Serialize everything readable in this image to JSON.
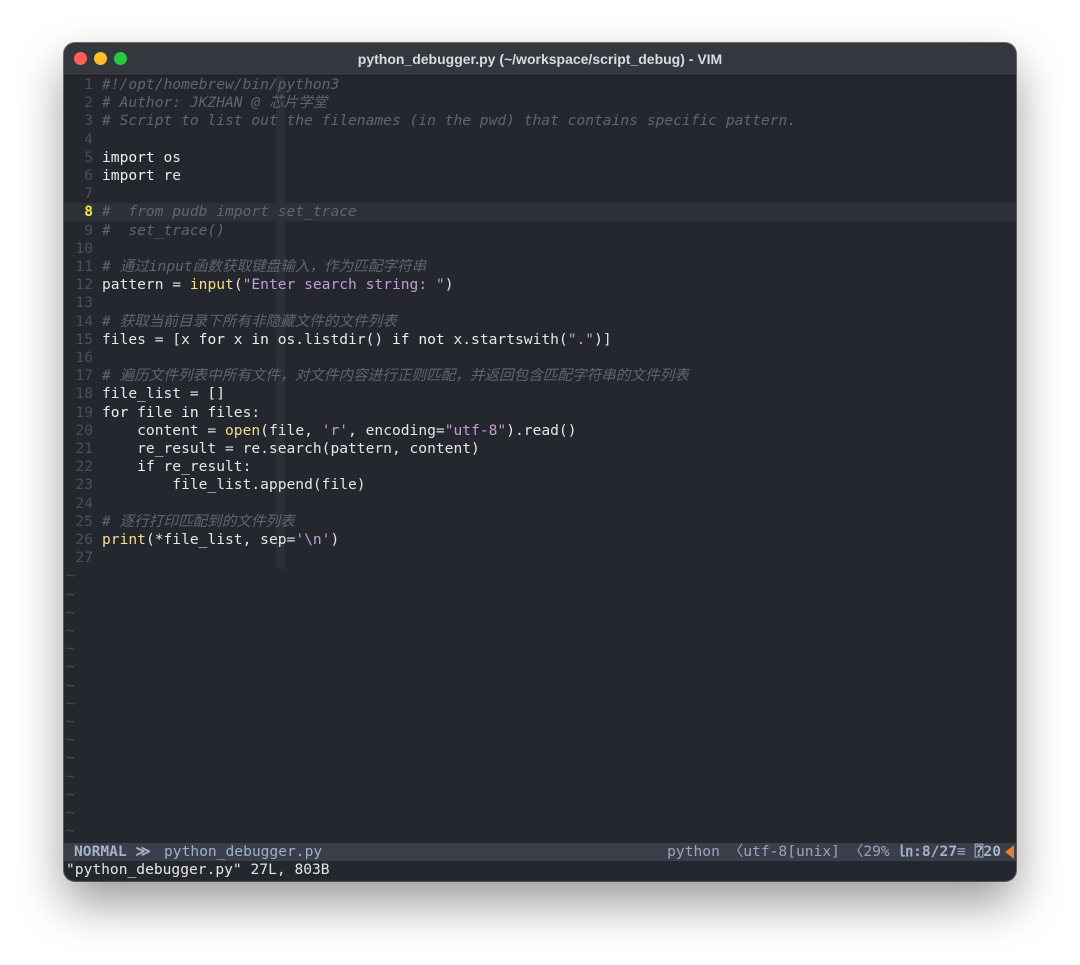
{
  "window": {
    "title": "python_debugger.py (~/workspace/script_debug) - VIM"
  },
  "editor": {
    "current_line": 8,
    "lines": [
      {
        "n": "1",
        "segs": [
          {
            "t": "#!/opt/homebrew/bin/python3",
            "c": "cm"
          }
        ]
      },
      {
        "n": "2",
        "segs": [
          {
            "t": "# Author: JKZHAN @ 芯片学堂",
            "c": "cm"
          }
        ]
      },
      {
        "n": "3",
        "segs": [
          {
            "t": "# Script to list out the filenames (in the pwd) that contains specific pattern.",
            "c": "cm"
          }
        ]
      },
      {
        "n": "4",
        "segs": []
      },
      {
        "n": "5",
        "segs": [
          {
            "t": "import",
            "c": "kw"
          },
          {
            "t": " os",
            "c": ""
          }
        ]
      },
      {
        "n": "6",
        "segs": [
          {
            "t": "import",
            "c": "kw"
          },
          {
            "t": " re",
            "c": ""
          }
        ]
      },
      {
        "n": "7",
        "segs": []
      },
      {
        "n": "8",
        "segs": [
          {
            "t": "#  from pudb import set_trace",
            "c": "cm"
          }
        ]
      },
      {
        "n": "9",
        "segs": [
          {
            "t": "#  set_trace()",
            "c": "cm"
          }
        ]
      },
      {
        "n": "10",
        "segs": []
      },
      {
        "n": "11",
        "segs": [
          {
            "t": "# 通过input函数获取键盘输入，作为匹配字符串",
            "c": "cm"
          }
        ]
      },
      {
        "n": "12",
        "segs": [
          {
            "t": "pattern = ",
            "c": ""
          },
          {
            "t": "input",
            "c": "fn"
          },
          {
            "t": "(",
            "c": ""
          },
          {
            "t": "\"Enter search string: \"",
            "c": "str"
          },
          {
            "t": ")",
            "c": ""
          }
        ]
      },
      {
        "n": "13",
        "segs": []
      },
      {
        "n": "14",
        "segs": [
          {
            "t": "# 获取当前目录下所有非隐藏文件的文件列表",
            "c": "cm"
          }
        ]
      },
      {
        "n": "15",
        "segs": [
          {
            "t": "files = [x ",
            "c": ""
          },
          {
            "t": "for",
            "c": "kw"
          },
          {
            "t": " x ",
            "c": ""
          },
          {
            "t": "in",
            "c": "kw"
          },
          {
            "t": " os.listdir() ",
            "c": ""
          },
          {
            "t": "if",
            "c": "kw"
          },
          {
            "t": " ",
            "c": ""
          },
          {
            "t": "not",
            "c": "kw"
          },
          {
            "t": " x.startswith(",
            "c": ""
          },
          {
            "t": "\".\"",
            "c": "str"
          },
          {
            "t": ")]",
            "c": ""
          }
        ]
      },
      {
        "n": "16",
        "segs": []
      },
      {
        "n": "17",
        "segs": [
          {
            "t": "# 遍历文件列表中所有文件，对文件内容进行正则匹配，并返回包含匹配字符串的文件列表",
            "c": "cm"
          }
        ]
      },
      {
        "n": "18",
        "segs": [
          {
            "t": "file_list = []",
            "c": ""
          }
        ]
      },
      {
        "n": "19",
        "segs": [
          {
            "t": "for",
            "c": "kw"
          },
          {
            "t": " file ",
            "c": ""
          },
          {
            "t": "in",
            "c": "kw"
          },
          {
            "t": " files:",
            "c": ""
          }
        ]
      },
      {
        "n": "20",
        "segs": [
          {
            "t": "    content = ",
            "c": ""
          },
          {
            "t": "open",
            "c": "fn"
          },
          {
            "t": "(file, ",
            "c": ""
          },
          {
            "t": "'r'",
            "c": "str"
          },
          {
            "t": ", encoding=",
            "c": ""
          },
          {
            "t": "\"utf-8\"",
            "c": "str"
          },
          {
            "t": ").read()",
            "c": ""
          }
        ]
      },
      {
        "n": "21",
        "segs": [
          {
            "t": "    re_result = re.search(pattern, content)",
            "c": ""
          }
        ]
      },
      {
        "n": "22",
        "segs": [
          {
            "t": "    ",
            "c": ""
          },
          {
            "t": "if",
            "c": "kw"
          },
          {
            "t": " re_result:",
            "c": ""
          }
        ]
      },
      {
        "n": "23",
        "segs": [
          {
            "t": "        file_list.append(file)",
            "c": ""
          }
        ]
      },
      {
        "n": "24",
        "segs": []
      },
      {
        "n": "25",
        "segs": [
          {
            "t": "# 逐行打印匹配到的文件列表",
            "c": "cm"
          }
        ]
      },
      {
        "n": "26",
        "segs": [
          {
            "t": "print",
            "c": "fn"
          },
          {
            "t": "(*file_list, sep=",
            "c": ""
          },
          {
            "t": "'\\n'",
            "c": "str"
          },
          {
            "t": ")",
            "c": ""
          }
        ]
      },
      {
        "n": "27",
        "segs": []
      }
    ],
    "filler_char": "~",
    "filler_count": 15
  },
  "statusline": {
    "mode": "NORMAL",
    "mode_sep": "≫",
    "filename": "python_debugger.py",
    "filetype": "python",
    "sep_left": "〈",
    "encoding": "utf-8[unix]",
    "percent": "29%",
    "ln_symbol": "㏑",
    "position": ":8/27",
    "lines_icon": "≡",
    "col_icon": "⍰",
    "column": "20"
  },
  "cmdline": {
    "text": "\"python_debugger.py\" 27L, 803B"
  },
  "colors": {
    "background": "#24272e",
    "comment": "#5f6572",
    "string": "#c69bd6",
    "builtin": "#f5dc8a",
    "current_line_number": "#f0e449",
    "statusline_bg": "#3a3f4b",
    "warning": "#e4802e"
  }
}
